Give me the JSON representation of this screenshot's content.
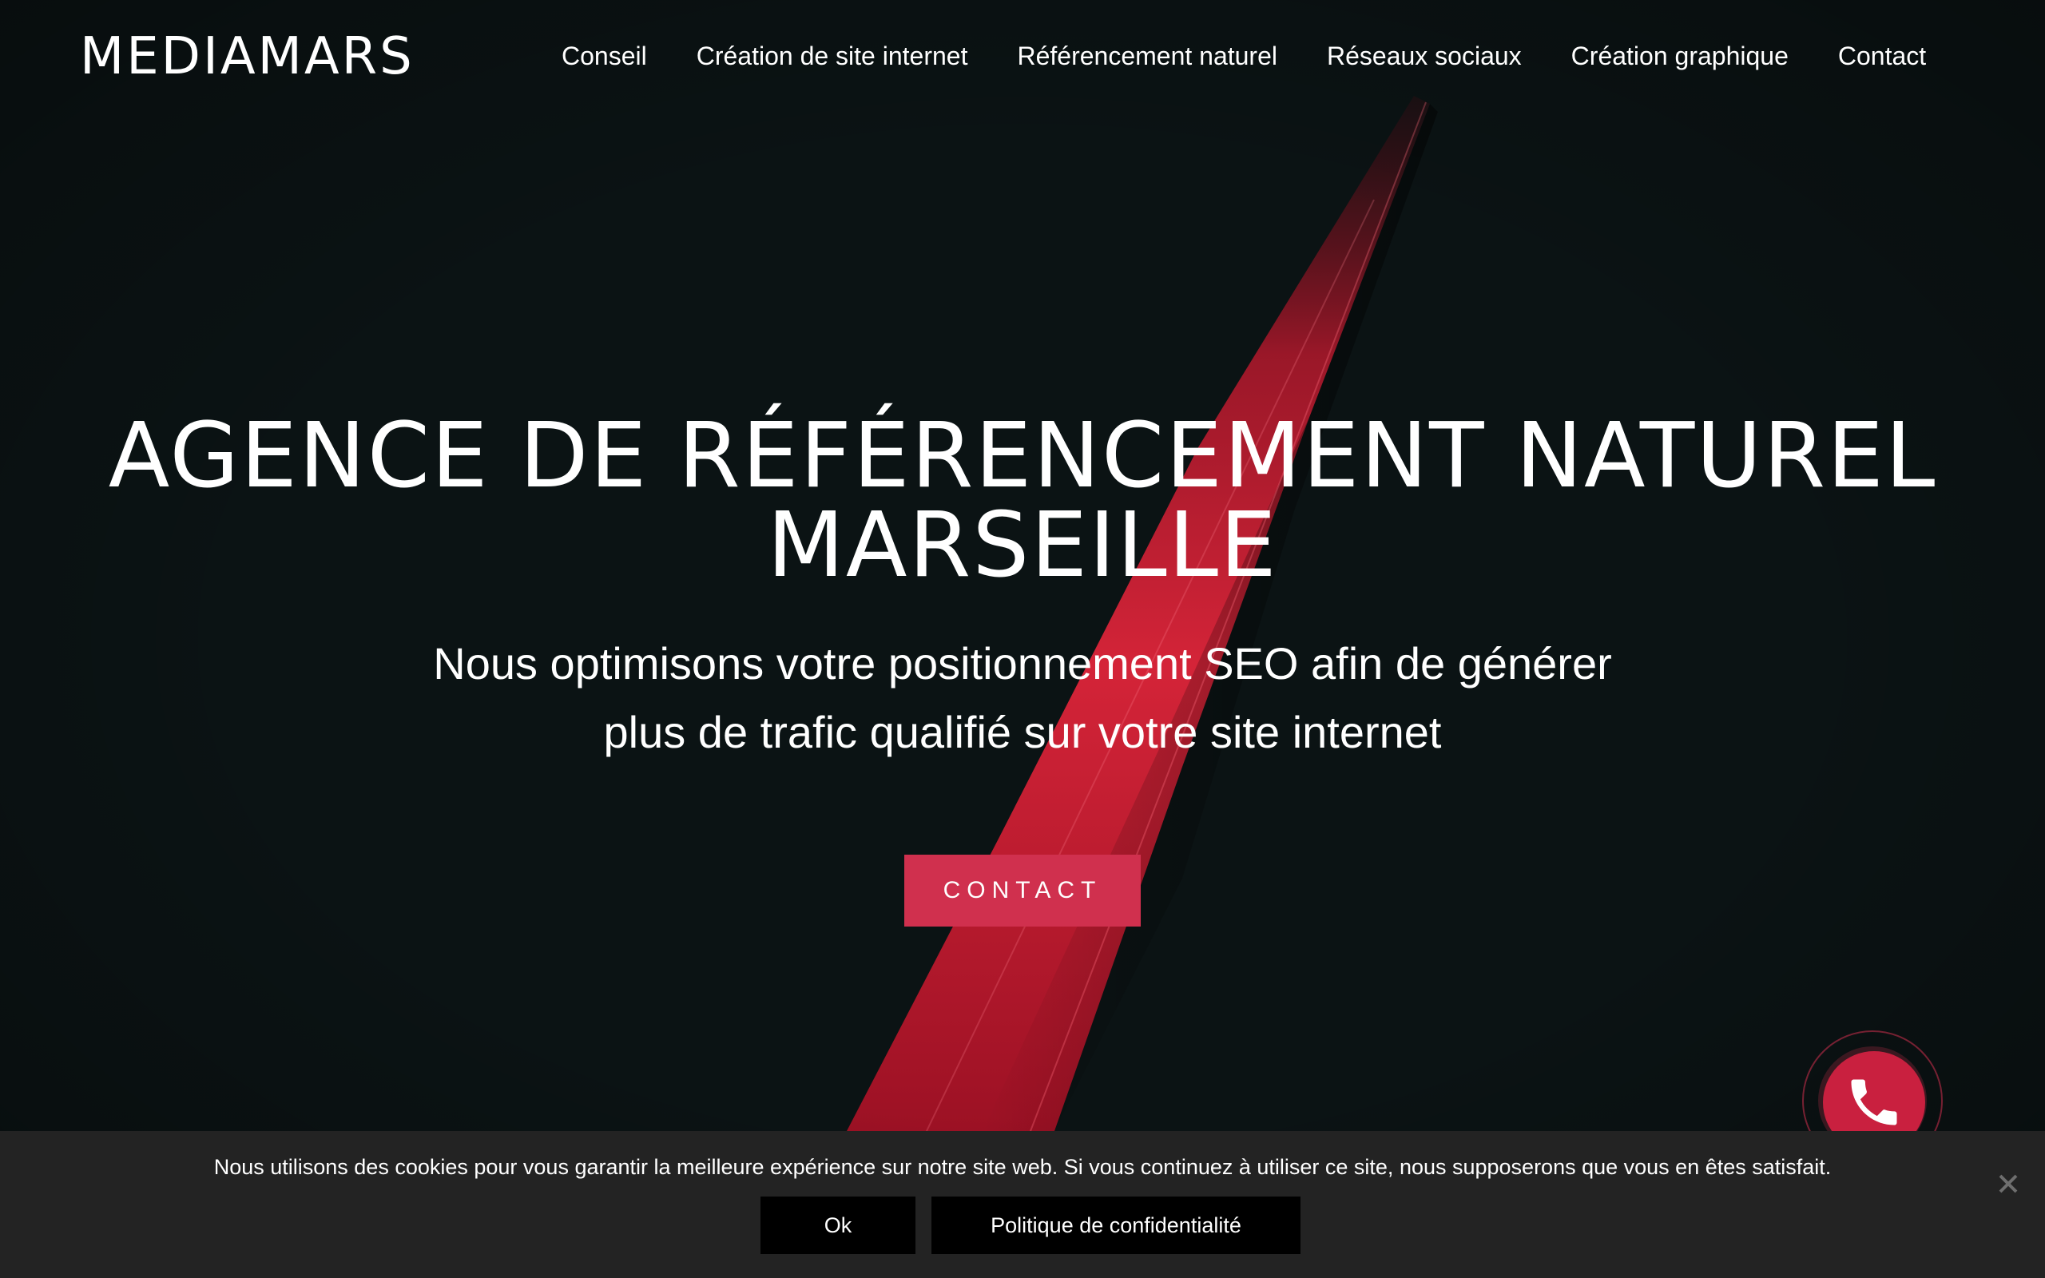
{
  "header": {
    "logo": "MEDIAMARS",
    "nav": [
      {
        "label": "Conseil"
      },
      {
        "label": "Création de site internet"
      },
      {
        "label": "Référencement naturel"
      },
      {
        "label": "Réseaux sociaux"
      },
      {
        "label": "Création graphique"
      },
      {
        "label": "Contact"
      }
    ]
  },
  "hero": {
    "title_line1": "AGENCE DE RÉFÉRENCEMENT NATUREL",
    "title_line2": "MARSEILLE",
    "subtitle_line1": "Nous optimisons votre positionnement SEO afin de générer",
    "subtitle_line2": "plus de trafic qualifié sur votre site internet",
    "cta_label": "CONTACT"
  },
  "phone_widget": {
    "icon": "phone-icon"
  },
  "cookie_bar": {
    "text": "Nous utilisons des cookies pour vous garantir la meilleure expérience sur notre site web. Si vous continuez à utiliser ce site, nous supposerons que vous en êtes satisfait.",
    "ok_label": "Ok",
    "policy_label": "Politique de confidentialité",
    "close_icon": "close-icon"
  },
  "colors": {
    "background": "#0b1314",
    "accent": "#d0304e",
    "cookie_bar": "#232323"
  }
}
